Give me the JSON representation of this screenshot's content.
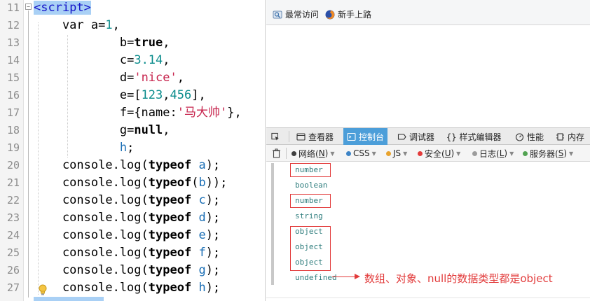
{
  "editor": {
    "lines": [
      {
        "num": "11",
        "parts": [
          {
            "t": "<script>",
            "c": "tag-hl"
          }
        ]
      },
      {
        "num": "12",
        "parts": [
          {
            "t": "    var ",
            "c": "kw-plain"
          },
          {
            "t": "a",
            "c": ""
          },
          {
            "t": "=",
            "c": ""
          },
          {
            "t": "1",
            "c": "num"
          },
          {
            "t": ",",
            "c": ""
          }
        ]
      },
      {
        "num": "13",
        "parts": [
          {
            "t": "            ",
            "c": ""
          },
          {
            "t": "b",
            "c": ""
          },
          {
            "t": "=",
            "c": ""
          },
          {
            "t": "true",
            "c": "kw"
          },
          {
            "t": ",",
            "c": ""
          }
        ]
      },
      {
        "num": "14",
        "parts": [
          {
            "t": "            ",
            "c": ""
          },
          {
            "t": "c",
            "c": ""
          },
          {
            "t": "=",
            "c": ""
          },
          {
            "t": "3.14",
            "c": "num"
          },
          {
            "t": ",",
            "c": ""
          }
        ]
      },
      {
        "num": "15",
        "parts": [
          {
            "t": "            ",
            "c": ""
          },
          {
            "t": "d",
            "c": ""
          },
          {
            "t": "=",
            "c": ""
          },
          {
            "t": "'nice'",
            "c": "str"
          },
          {
            "t": ",",
            "c": ""
          }
        ]
      },
      {
        "num": "16",
        "parts": [
          {
            "t": "            ",
            "c": ""
          },
          {
            "t": "e",
            "c": ""
          },
          {
            "t": "=[",
            "c": ""
          },
          {
            "t": "123",
            "c": "num"
          },
          {
            "t": ",",
            "c": ""
          },
          {
            "t": "456",
            "c": "num"
          },
          {
            "t": "],",
            "c": ""
          }
        ]
      },
      {
        "num": "17",
        "parts": [
          {
            "t": "            ",
            "c": ""
          },
          {
            "t": "f",
            "c": ""
          },
          {
            "t": "={name:",
            "c": ""
          },
          {
            "t": "'马大帅'",
            "c": "str"
          },
          {
            "t": "},",
            "c": ""
          }
        ]
      },
      {
        "num": "18",
        "parts": [
          {
            "t": "            ",
            "c": ""
          },
          {
            "t": "g",
            "c": ""
          },
          {
            "t": "=",
            "c": ""
          },
          {
            "t": "null",
            "c": "kw"
          },
          {
            "t": ",",
            "c": ""
          }
        ]
      },
      {
        "num": "19",
        "parts": [
          {
            "t": "            ",
            "c": ""
          },
          {
            "t": "h",
            "c": "var"
          },
          {
            "t": ";",
            "c": ""
          }
        ]
      },
      {
        "num": "20",
        "parts": [
          {
            "t": "    console.log(",
            "c": ""
          },
          {
            "t": "typeof",
            "c": "kw"
          },
          {
            "t": " ",
            "c": ""
          },
          {
            "t": "a",
            "c": "var"
          },
          {
            "t": ");",
            "c": ""
          }
        ]
      },
      {
        "num": "21",
        "parts": [
          {
            "t": "    console.log(",
            "c": ""
          },
          {
            "t": "typeof",
            "c": "kw"
          },
          {
            "t": "(",
            "c": ""
          },
          {
            "t": "b",
            "c": "var"
          },
          {
            "t": "));",
            "c": ""
          }
        ]
      },
      {
        "num": "22",
        "parts": [
          {
            "t": "    console.log(",
            "c": ""
          },
          {
            "t": "typeof",
            "c": "kw"
          },
          {
            "t": " ",
            "c": ""
          },
          {
            "t": "c",
            "c": "var"
          },
          {
            "t": ");",
            "c": ""
          }
        ]
      },
      {
        "num": "23",
        "parts": [
          {
            "t": "    console.log(",
            "c": ""
          },
          {
            "t": "typeof",
            "c": "kw"
          },
          {
            "t": " ",
            "c": ""
          },
          {
            "t": "d",
            "c": "var"
          },
          {
            "t": ");",
            "c": ""
          }
        ]
      },
      {
        "num": "24",
        "parts": [
          {
            "t": "    console.log(",
            "c": ""
          },
          {
            "t": "typeof",
            "c": "kw"
          },
          {
            "t": " ",
            "c": ""
          },
          {
            "t": "e",
            "c": "var"
          },
          {
            "t": ");",
            "c": ""
          }
        ]
      },
      {
        "num": "25",
        "parts": [
          {
            "t": "    console.log(",
            "c": ""
          },
          {
            "t": "typeof",
            "c": "kw"
          },
          {
            "t": " ",
            "c": ""
          },
          {
            "t": "f",
            "c": "var"
          },
          {
            "t": ");",
            "c": ""
          }
        ]
      },
      {
        "num": "26",
        "parts": [
          {
            "t": "    console.log(",
            "c": ""
          },
          {
            "t": "typeof",
            "c": "kw"
          },
          {
            "t": " ",
            "c": ""
          },
          {
            "t": "g",
            "c": "var"
          },
          {
            "t": ");",
            "c": ""
          }
        ]
      },
      {
        "num": "27",
        "parts": [
          {
            "t": "    console.log(",
            "c": ""
          },
          {
            "t": "typeof",
            "c": "kw"
          },
          {
            "t": " ",
            "c": ""
          },
          {
            "t": "h",
            "c": "var"
          },
          {
            "t": ");",
            "c": ""
          }
        ]
      }
    ]
  },
  "bookmarks": {
    "most_visited": "最常访问",
    "new_user": "新手上路"
  },
  "devtools": {
    "tabs": {
      "inspector": "查看器",
      "console": "控制台",
      "debugger": "调试器",
      "style_editor": "样式编辑器",
      "performance": "性能",
      "memory": "内存"
    },
    "filters": {
      "net": "网络(",
      "net_key": "N",
      "css": "CSS",
      "js": "JS",
      "security": "安全(",
      "security_key": "U",
      "logging": "日志(",
      "logging_key": "L",
      "server": "服务器(",
      "server_key": "S",
      "close_paren": ")"
    },
    "colors": {
      "net": "#3f3f3f",
      "css": "#3e84c6",
      "js": "#e8a32e",
      "security": "#e33b3b",
      "logging": "#9c9c9c",
      "server": "#52a352"
    },
    "console_output": [
      "number",
      "boolean",
      "number",
      "string",
      "object",
      "object",
      "object",
      "undefined"
    ]
  },
  "annotation": "数组、对象、null的数据类型都是object"
}
